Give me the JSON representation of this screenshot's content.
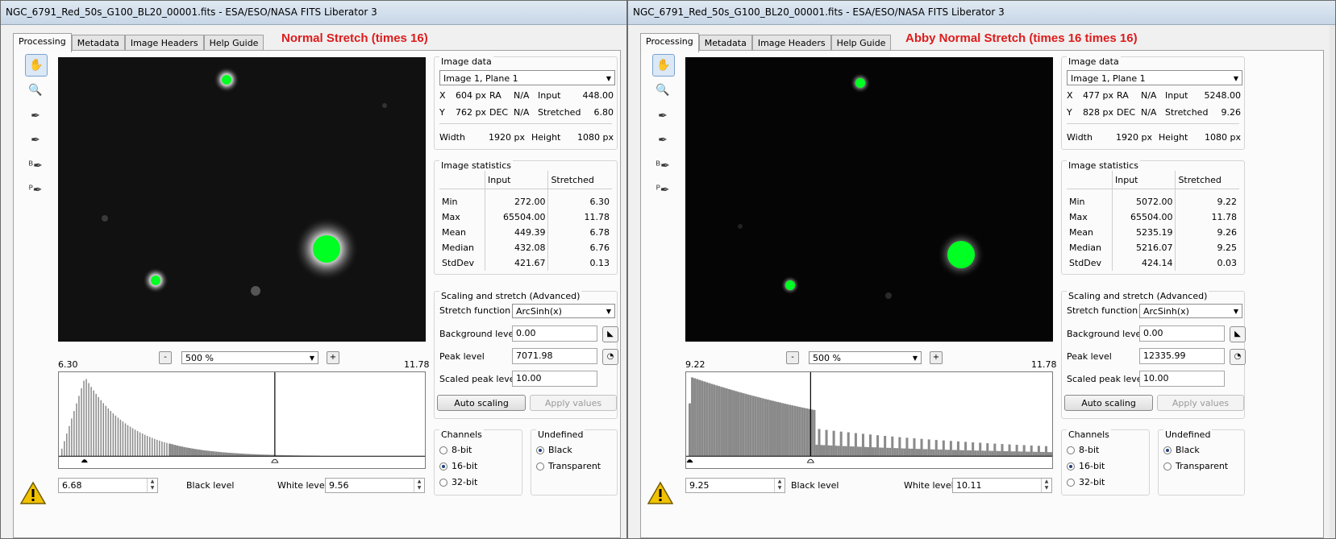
{
  "windows": [
    {
      "title": "NGC_6791_Red_50s_G100_BL20_00001.fits - ESA/ESO/NASA FITS Liberator 3",
      "tabs": [
        "Processing",
        "Metadata",
        "Image Headers",
        "Help Guide"
      ],
      "stretch_title": "Normal Stretch (times 16)",
      "zoom": "500 %",
      "zoom_minus": "-",
      "zoom_plus": "+",
      "hist_min": "6.30",
      "hist_max": "11.78",
      "black_level_label": "Black level",
      "black_level": "6.68",
      "white_level_label": "White level",
      "white_level": "9.56",
      "image_data": {
        "title": "Image data",
        "plane": "Image 1, Plane 1",
        "x_label": "X",
        "x": "604 px",
        "ra_label": "RA",
        "ra": "N/A",
        "input_label": "Input",
        "input": "448.00",
        "y_label": "Y",
        "y": "762 px",
        "dec_label": "DEC",
        "dec": "N/A",
        "stretched_label": "Stretched",
        "stretched": "6.80",
        "width_label": "Width",
        "width": "1920 px",
        "height_label": "Height",
        "height": "1080 px"
      },
      "stats": {
        "title": "Image statistics",
        "col_input": "Input",
        "col_stretched": "Stretched",
        "rows": [
          {
            "label": "Min",
            "input": "272.00",
            "stretched": "6.30"
          },
          {
            "label": "Max",
            "input": "65504.00",
            "stretched": "11.78"
          },
          {
            "label": "Mean",
            "input": "449.39",
            "stretched": "6.78"
          },
          {
            "label": "Median",
            "input": "432.08",
            "stretched": "6.76"
          },
          {
            "label": "StdDev",
            "input": "421.67",
            "stretched": "0.13"
          }
        ]
      },
      "scaling": {
        "title": "Scaling and stretch (Advanced)",
        "function_label": "Stretch function",
        "function": "ArcSinh(x)",
        "bg_label": "Background level",
        "bg": "0.00",
        "peak_label": "Peak level",
        "peak": "7071.98",
        "scaled_label": "Scaled peak level",
        "scaled": "10.00",
        "auto_btn": "Auto scaling",
        "apply_btn": "Apply values"
      },
      "channels": {
        "title": "Channels",
        "options": [
          "8-bit",
          "16-bit",
          "32-bit"
        ],
        "selected": "16-bit"
      },
      "undefined": {
        "title": "Undefined",
        "options": [
          "Black",
          "Transparent"
        ],
        "selected": "Black"
      },
      "histogram": {
        "black_marker": 0.07,
        "white_marker": 0.59,
        "peak_at": 0.07,
        "shape": "wide"
      }
    },
    {
      "title": "NGC_6791_Red_50s_G100_BL20_00001.fits - ESA/ESO/NASA FITS Liberator 3",
      "tabs": [
        "Processing",
        "Metadata",
        "Image Headers",
        "Help Guide"
      ],
      "stretch_title": "Abby Normal Stretch (times 16 times 16)",
      "zoom": "500 %",
      "zoom_minus": "-",
      "zoom_plus": "+",
      "hist_min": "9.22",
      "hist_max": "11.78",
      "black_level_label": "Black level",
      "black_level": "9.25",
      "white_level_label": "White level",
      "white_level": "10.11",
      "image_data": {
        "title": "Image data",
        "plane": "Image 1, Plane 1",
        "x_label": "X",
        "x": "477 px",
        "ra_label": "RA",
        "ra": "N/A",
        "input_label": "Input",
        "input": "5248.00",
        "y_label": "Y",
        "y": "828 px",
        "dec_label": "DEC",
        "dec": "N/A",
        "stretched_label": "Stretched",
        "stretched": "9.26",
        "width_label": "Width",
        "width": "1920 px",
        "height_label": "Height",
        "height": "1080 px"
      },
      "stats": {
        "title": "Image statistics",
        "col_input": "Input",
        "col_stretched": "Stretched",
        "rows": [
          {
            "label": "Min",
            "input": "5072.00",
            "stretched": "9.22"
          },
          {
            "label": "Max",
            "input": "65504.00",
            "stretched": "11.78"
          },
          {
            "label": "Mean",
            "input": "5235.19",
            "stretched": "9.26"
          },
          {
            "label": "Median",
            "input": "5216.07",
            "stretched": "9.25"
          },
          {
            "label": "StdDev",
            "input": "424.14",
            "stretched": "0.03"
          }
        ]
      },
      "scaling": {
        "title": "Scaling and stretch (Advanced)",
        "function_label": "Stretch function",
        "function": "ArcSinh(x)",
        "bg_label": "Background level",
        "bg": "0.00",
        "peak_label": "Peak level",
        "peak": "12335.99",
        "scaled_label": "Scaled peak level",
        "scaled": "10.00",
        "auto_btn": "Auto scaling",
        "apply_btn": "Apply values"
      },
      "channels": {
        "title": "Channels",
        "options": [
          "8-bit",
          "16-bit",
          "32-bit"
        ],
        "selected": "16-bit"
      },
      "undefined": {
        "title": "Undefined",
        "options": [
          "Black",
          "Transparent"
        ],
        "selected": "Black"
      },
      "histogram": {
        "black_marker": 0.01,
        "white_marker": 0.34,
        "peak_at": 0.01,
        "shape": "narrow"
      }
    }
  ],
  "colors": {
    "title_red": "#dd1c1c",
    "star_green": "#00ff22",
    "histogram_bar": "#8a8a8a"
  },
  "icons": [
    "hand-icon",
    "zoom-icon",
    "eyedropper-icon",
    "eyedropper-plus-icon",
    "background-picker-icon",
    "peak-picker-icon",
    "warning-icon"
  ]
}
